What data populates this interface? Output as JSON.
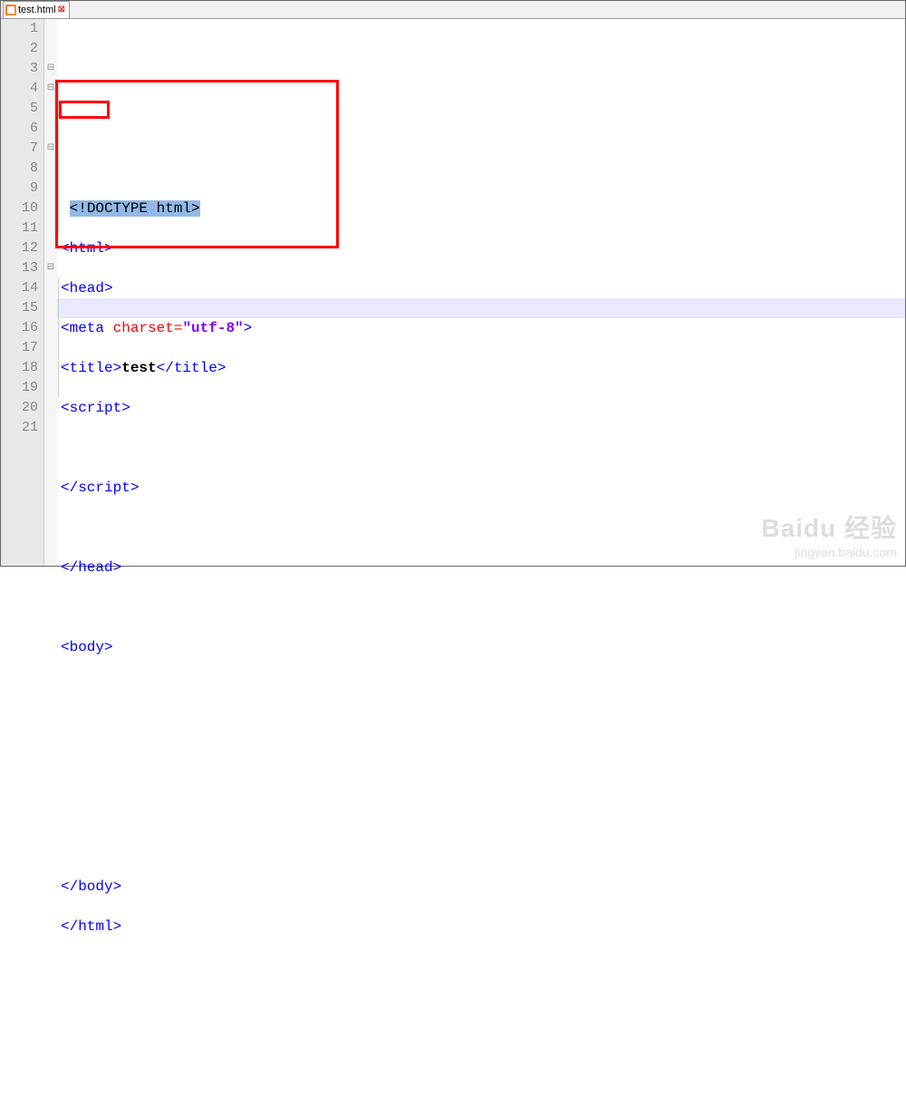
{
  "tab": {
    "label": "test.html"
  },
  "gutter": [
    "1",
    "2",
    "3",
    "4",
    "5",
    "6",
    "7",
    "8",
    "9",
    "10",
    "11",
    "12",
    "13",
    "14",
    "15",
    "16",
    "17",
    "18",
    "19",
    "20",
    "21"
  ],
  "fold": [
    "",
    "",
    "⊟",
    "⊟",
    "",
    "",
    "⊟",
    "",
    "",
    "",
    "",
    "",
    "⊟",
    "",
    "",
    "",
    "",
    "",
    "",
    "",
    ""
  ],
  "code": {
    "l1": "",
    "l2a": "<!",
    "l2b": "DOCTYPE html",
    "l2c": ">",
    "l3": "<html>",
    "l4": "<head>",
    "l5a": "<meta",
    "l5b": " charset=",
    "l5c": "\"utf-8\"",
    "l5d": ">",
    "l6a": "<title>",
    "l6b": "test",
    "l6c": "</title>",
    "l7": "<script>",
    "l8": "",
    "l9": "</script>",
    "l10": "",
    "l11": "</head>",
    "l12": "",
    "l13": "<body>",
    "l14": "",
    "l15": "",
    "l16": "",
    "l17": "",
    "l18": "",
    "l19": "</body>",
    "l20": "</html>",
    "l21": ""
  },
  "watermark": {
    "big": "Baidu 经验",
    "small": "jingyan.baidu.com"
  }
}
